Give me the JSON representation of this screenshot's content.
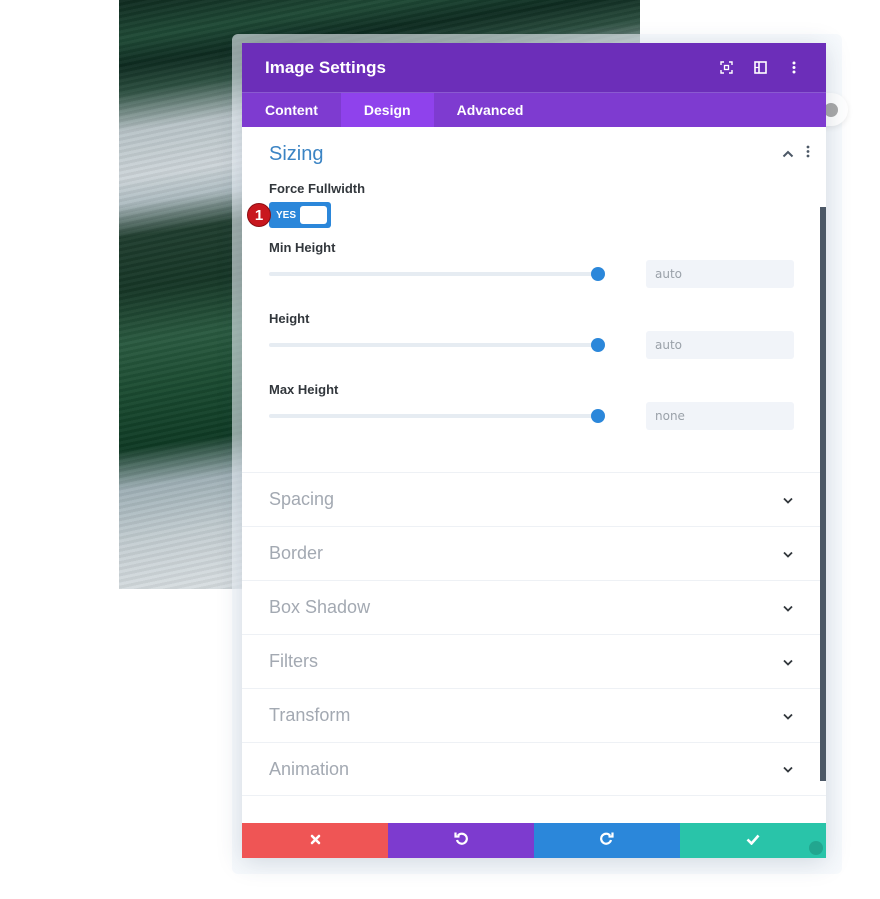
{
  "modal": {
    "title": "Image Settings",
    "header_icons": [
      "focus-icon",
      "split-view-icon",
      "more-vertical-icon"
    ]
  },
  "tabs": [
    {
      "label": "Content",
      "active": false
    },
    {
      "label": "Design",
      "active": true
    },
    {
      "label": "Advanced",
      "active": false
    }
  ],
  "sizing": {
    "title": "Sizing",
    "expanded": true,
    "force_fullwidth": {
      "label": "Force Fullwidth",
      "value": "YES",
      "enabled": true,
      "annotation_badge": "1"
    },
    "fields": [
      {
        "label": "Min Height",
        "value": "auto",
        "slider_fraction": 1.0
      },
      {
        "label": "Height",
        "value": "auto",
        "slider_fraction": 1.0
      },
      {
        "label": "Max Height",
        "value": "none",
        "slider_fraction": 1.0
      }
    ]
  },
  "collapsed_sections": [
    {
      "title": "Spacing"
    },
    {
      "title": "Border"
    },
    {
      "title": "Box Shadow"
    },
    {
      "title": "Filters"
    },
    {
      "title": "Transform"
    },
    {
      "title": "Animation"
    }
  ],
  "footer": {
    "buttons": [
      {
        "name": "cancel",
        "icon": "close-icon",
        "color": "#ef5555"
      },
      {
        "name": "undo",
        "icon": "undo-icon",
        "color": "#7d3bcf"
      },
      {
        "name": "redo",
        "icon": "redo-icon",
        "color": "#2b87da"
      },
      {
        "name": "save",
        "icon": "check-icon",
        "color": "#29c4a9"
      }
    ]
  },
  "colors": {
    "header": "#6c2eb9",
    "tabs": "#7e3bd0",
    "active_tab": "#8f42ec",
    "accent": "#2b87da"
  }
}
